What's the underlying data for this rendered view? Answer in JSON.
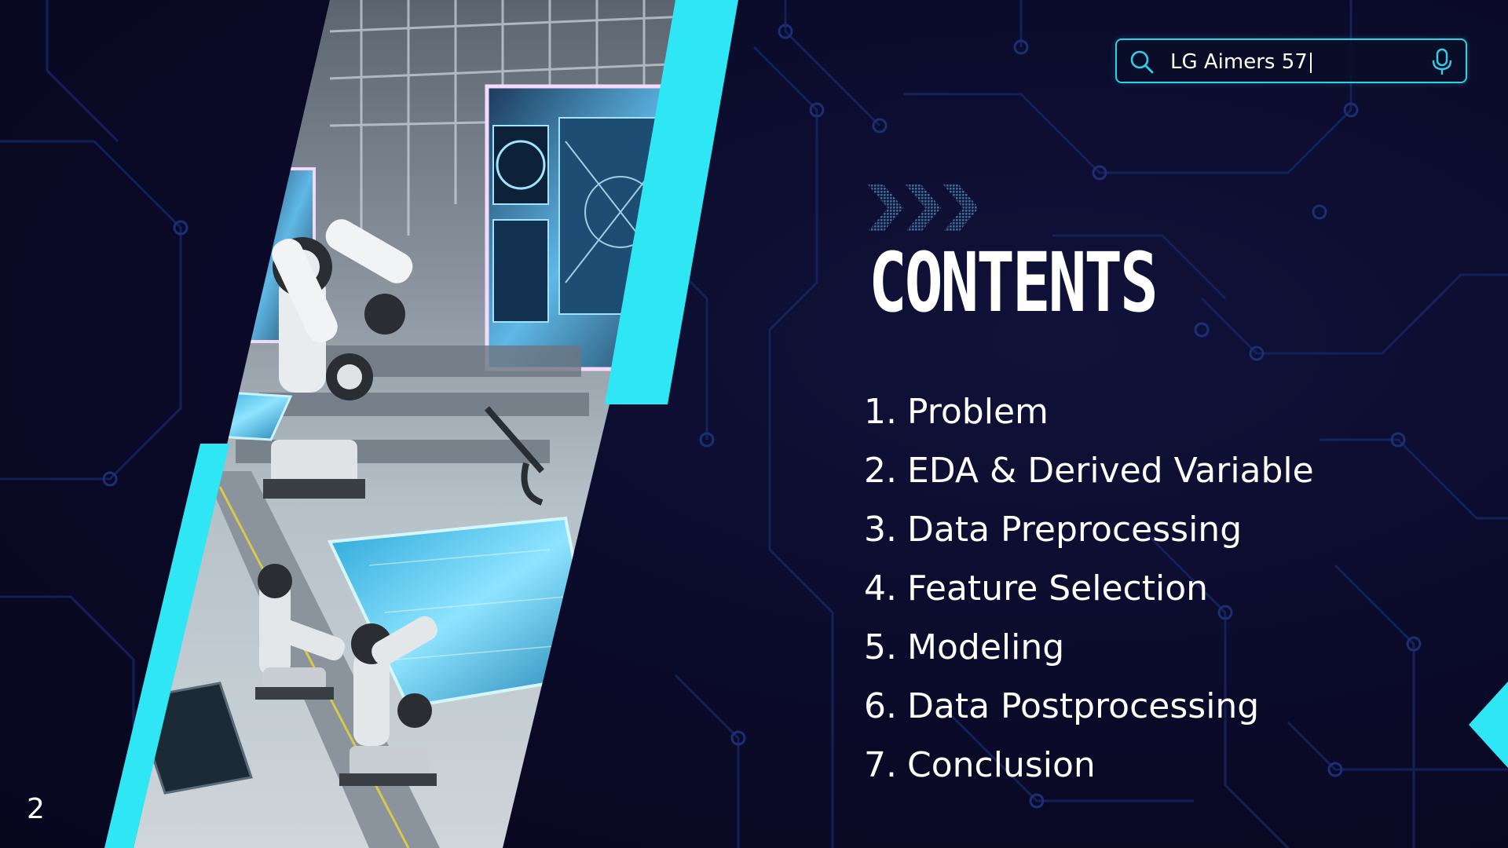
{
  "search": {
    "query": "LG Aimers 57",
    "icon": "search-icon",
    "voice_icon": "microphone-icon"
  },
  "slide": {
    "title": "CONTENTS",
    "page_number": "2"
  },
  "toc": [
    {
      "num": "1.",
      "label": "Problem"
    },
    {
      "num": "2.",
      "label": "EDA & Derived Variable"
    },
    {
      "num": "3.",
      "label": "Data Preprocessing"
    },
    {
      "num": "4.",
      "label": "Feature Selection"
    },
    {
      "num": "5.",
      "label": "Modeling"
    },
    {
      "num": "6.",
      "label": "Data Postprocessing"
    },
    {
      "num": "7.",
      "label": "Conclusion"
    }
  ],
  "colors": {
    "background": "#0a0a26",
    "accent_cyan": "#2fe6f5",
    "text": "#ffffff",
    "circuit": "#1a2a6a"
  }
}
